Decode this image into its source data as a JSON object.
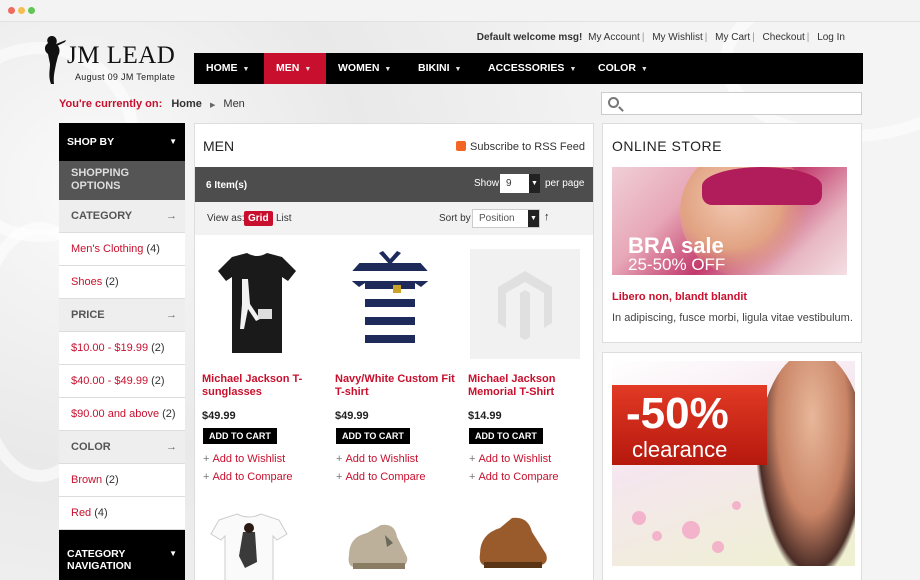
{
  "top_links": [
    "Default welcome msg!",
    "My Account",
    "My Wishlist",
    "My Cart",
    "Checkout",
    "Log In"
  ],
  "logo": {
    "title": "JM LEAD",
    "tagline": "August 09 JM Template"
  },
  "nav": [
    {
      "label": "HOME",
      "active": false
    },
    {
      "label": "MEN",
      "active": true
    },
    {
      "label": "WOMEN",
      "active": false
    },
    {
      "label": "BIKINI",
      "active": false
    },
    {
      "label": "ACCESSORIES",
      "active": false
    },
    {
      "label": "COLOR",
      "active": false
    }
  ],
  "breadcrumb": {
    "label": "You're currently on:",
    "home": "Home",
    "current": "Men"
  },
  "search": {
    "placeholder": "",
    "icon": "search-icon"
  },
  "sidebar": {
    "shop_by": "SHOP BY",
    "shopping_options": "SHOPPING OPTIONS",
    "category": {
      "title": "CATEGORY",
      "items": [
        {
          "name": "Men's Clothing",
          "count": "(4)"
        },
        {
          "name": "Shoes",
          "count": "(2)"
        }
      ]
    },
    "price": {
      "title": "PRICE",
      "items": [
        {
          "name": "$10.00 - $19.99",
          "count": "(2)"
        },
        {
          "name": "$40.00 - $49.99",
          "count": "(2)"
        },
        {
          "name": "$90.00 and above",
          "count": "(2)"
        }
      ]
    },
    "color": {
      "title": "COLOR",
      "items": [
        {
          "name": "Brown",
          "count": "(2)"
        },
        {
          "name": "Red",
          "count": "(4)"
        }
      ]
    },
    "category_navigation": "CATEGORY NAVIGATION"
  },
  "main": {
    "title": "MEN",
    "rss": "Subscribe to RSS Feed",
    "item_count": "6 Item(s)",
    "show_label": "Show",
    "show_value": "9",
    "per_page": "per page",
    "view_as": "View as:",
    "grid": "Grid",
    "list": "List",
    "sort_by": "Sort by",
    "sort_value": "Position",
    "products": [
      {
        "name": "Michael Jackson T-sunglasses",
        "price": "$49.99"
      },
      {
        "name": "Navy/White Custom Fit T-shirt",
        "price": "$49.99"
      },
      {
        "name": "Michael Jackson Memorial T-Shirt",
        "price": "$14.99"
      }
    ],
    "add_to_cart": "ADD TO CART",
    "add_to_wishlist": "Add to Wishlist",
    "add_to_compare": "Add to Compare"
  },
  "right": {
    "online_store": "ONLINE STORE",
    "banner1_line1": "BRA sale",
    "banner1_line2": "25-50% OFF",
    "link_title": "Libero non, blandt blandit",
    "link_desc": "In adipiscing, fusce morbi, ligula vitae vestibulum.",
    "banner2_line1": "-50%",
    "banner2_line2": "clearance"
  },
  "colors": {
    "accent": "#c8102e",
    "nav_bg": "#000000",
    "toolbar_bg": "#4d4d4d"
  }
}
